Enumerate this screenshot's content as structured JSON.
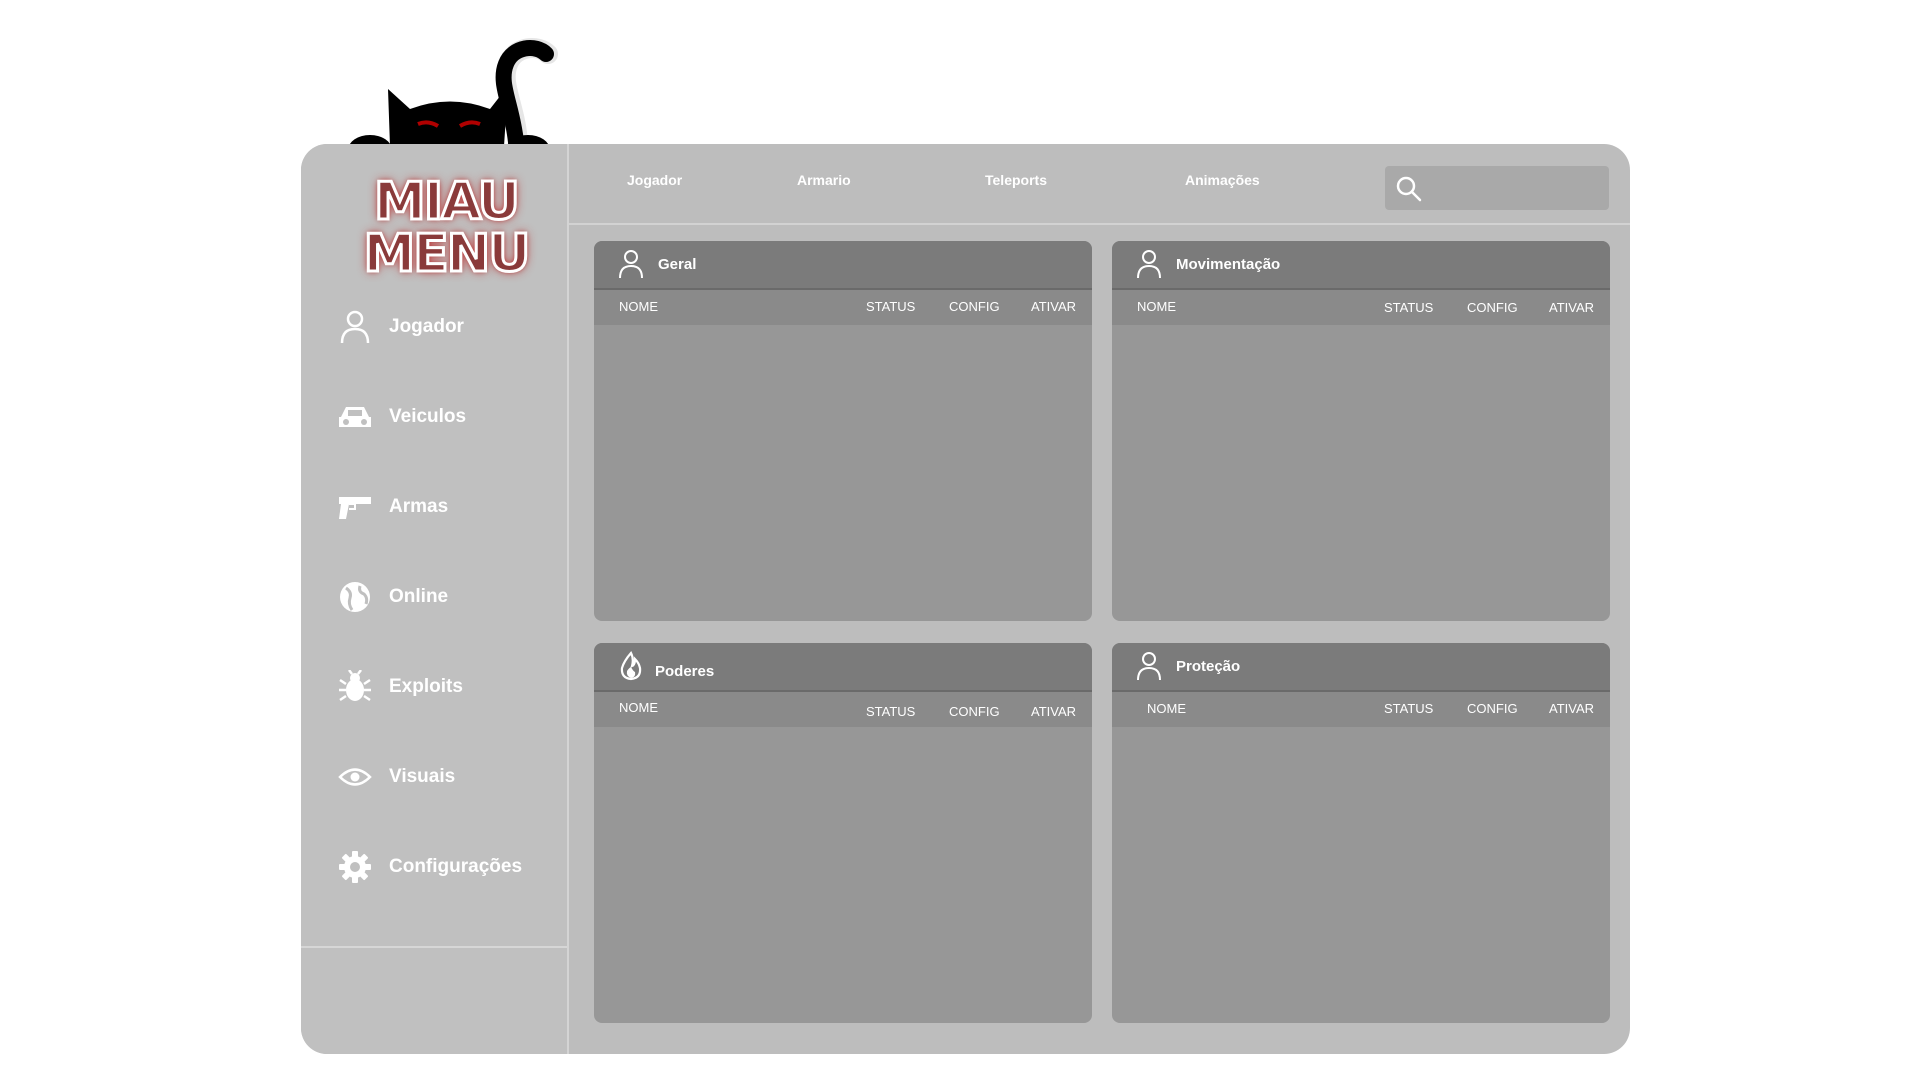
{
  "brand": {
    "logo_line1": "MIAU",
    "logo_line2": "MENU",
    "mascot": "cat-icon"
  },
  "sidebar": {
    "items": [
      {
        "label": "Jogador",
        "icon": "user-icon"
      },
      {
        "label": "Veiculos",
        "icon": "car-icon"
      },
      {
        "label": "Armas",
        "icon": "gun-icon"
      },
      {
        "label": "Online",
        "icon": "globe-icon"
      },
      {
        "label": "Exploits",
        "icon": "bug-icon"
      },
      {
        "label": "Visuais",
        "icon": "eye-icon"
      },
      {
        "label": "Configurações",
        "icon": "gear-icon"
      }
    ]
  },
  "topbar": {
    "tabs": [
      "Jogador",
      "Armario",
      "Teleports",
      "Animações"
    ],
    "search": {
      "placeholder": "",
      "icon": "search-icon"
    }
  },
  "panels": [
    {
      "title": "Geral",
      "icon": "user-icon",
      "columns": [
        "NOME",
        "STATUS",
        "CONFIG",
        "ATIVAR"
      ]
    },
    {
      "title": "Movimentação",
      "icon": "user-icon",
      "columns": [
        "NOME",
        "STATUS",
        "CONFIG",
        "ATIVAR"
      ]
    },
    {
      "title": "Poderes",
      "icon": "fire-icon",
      "columns": [
        "NOME",
        "STATUS",
        "CONFIG",
        "ATIVAR"
      ]
    },
    {
      "title": "Proteção",
      "icon": "user-icon",
      "columns": [
        "NOME",
        "STATUS",
        "CONFIG",
        "ATIVAR"
      ]
    }
  ],
  "colors": {
    "frame": "#bdbdbd",
    "panel_body": "#979797",
    "panel_header": "#7b7b7b",
    "logo_glow": "#be1e1e",
    "text": "#ffffff"
  }
}
